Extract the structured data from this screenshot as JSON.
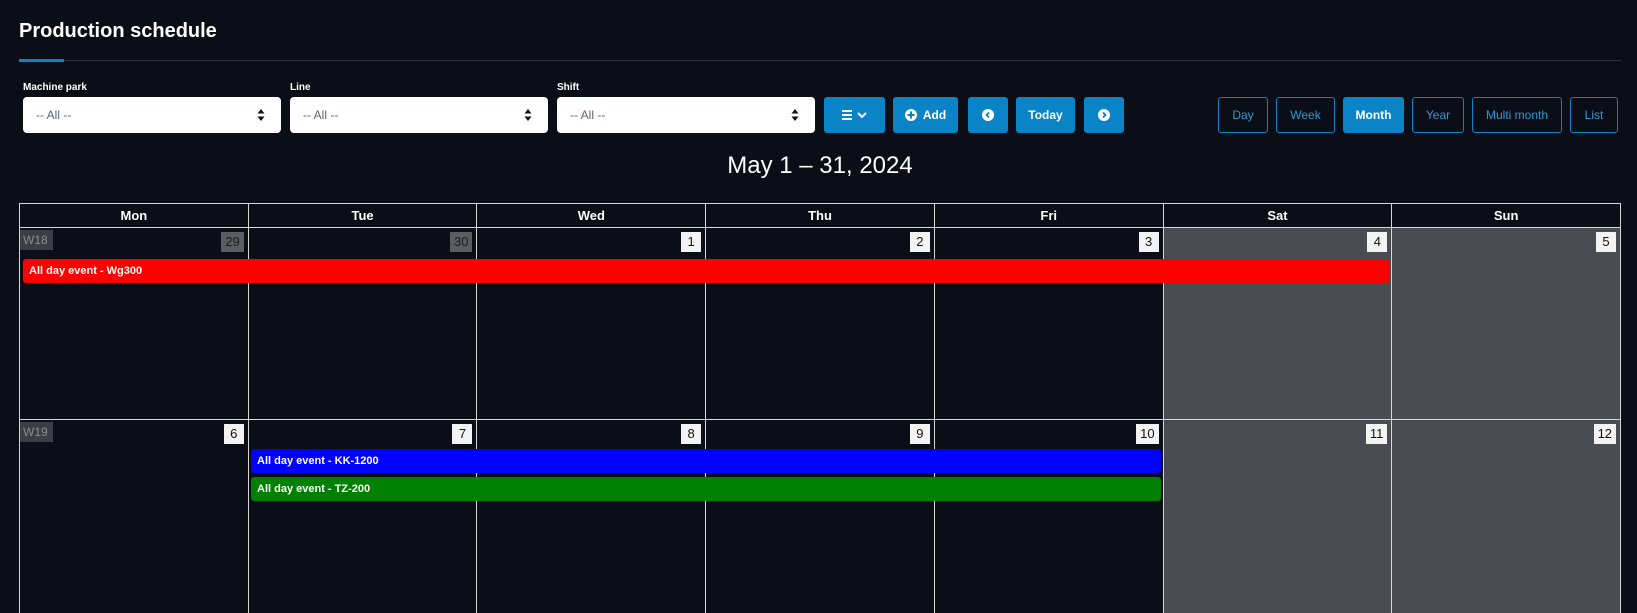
{
  "header": {
    "title": "Production schedule"
  },
  "filters": {
    "machine_park": {
      "label": "Machine park",
      "value": "-- All --"
    },
    "line": {
      "label": "Line",
      "value": "-- All --"
    },
    "shift": {
      "label": "Shift",
      "value": "-- All --"
    }
  },
  "toolbar": {
    "menu_icon": "hamburger-icon",
    "add_label": "Add",
    "today_label": "Today",
    "prev_icon": "chevron-left-circle-icon",
    "next_icon": "chevron-right-circle-icon",
    "accent_color": "#0a84c6"
  },
  "views": {
    "day": "Day",
    "week": "Week",
    "month": "Month",
    "year": "Year",
    "multi_month": "Multi month",
    "list": "List",
    "active": "Month"
  },
  "calendar": {
    "range_title": "May 1 – 31, 2024",
    "day_names": [
      "Mon",
      "Tue",
      "Wed",
      "Thu",
      "Fri",
      "Sat",
      "Sun"
    ],
    "weeks": [
      {
        "week_label": "W18",
        "days": [
          "29",
          "30",
          "1",
          "2",
          "3",
          "4",
          "5"
        ]
      },
      {
        "week_label": "W19",
        "days": [
          "6",
          "7",
          "8",
          "9",
          "10",
          "11",
          "12"
        ]
      }
    ],
    "events": [
      {
        "title": "All day event - Wg300",
        "color": "#ff0000"
      },
      {
        "title": "All day event - KK-1200",
        "color": "#0000ff"
      },
      {
        "title": "All day event - TZ-200",
        "color": "#008000"
      }
    ],
    "weekend_color": "#484b52"
  }
}
